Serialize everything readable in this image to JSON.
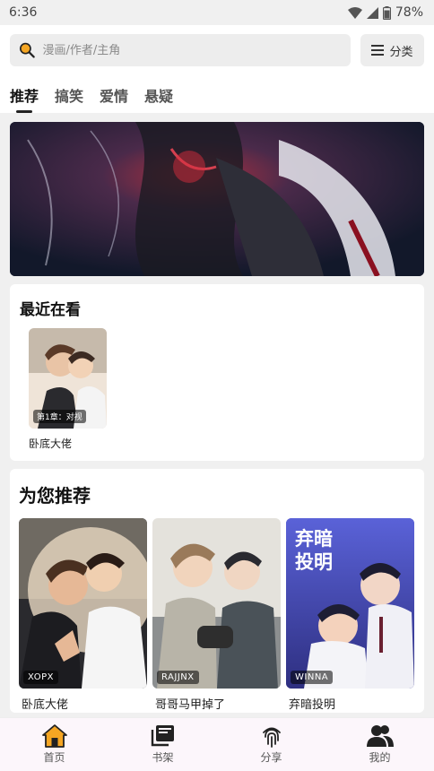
{
  "status": {
    "time": "6:36",
    "battery": "78%"
  },
  "search": {
    "placeholder": "漫画/作者/主角"
  },
  "category_button": {
    "label": "分类"
  },
  "tabs": [
    {
      "label": "推荐",
      "active": true
    },
    {
      "label": "搞笑",
      "active": false
    },
    {
      "label": "爱情",
      "active": false
    },
    {
      "label": "悬疑",
      "active": false
    }
  ],
  "recent": {
    "title": "最近在看",
    "items": [
      {
        "name": "卧底大佬",
        "chapter": "第1章：对视"
      }
    ]
  },
  "recommend": {
    "title": "为您推荐",
    "items": [
      {
        "name": "卧底大佬",
        "author": "XOPX"
      },
      {
        "name": "哥哥马甲掉了",
        "author": "RAJJNX"
      },
      {
        "name": "弃暗投明",
        "author": "WINNA",
        "cover_title": "弃暗投明"
      }
    ]
  },
  "bottom_nav": [
    {
      "label": "首页",
      "icon": "home-icon",
      "active": true
    },
    {
      "label": "书架",
      "icon": "bookshelf-icon",
      "active": false
    },
    {
      "label": "分享",
      "icon": "fingerprint-icon",
      "active": false
    },
    {
      "label": "我的",
      "icon": "users-icon",
      "active": false
    }
  ],
  "colors": {
    "accent": "#f5a623",
    "dark": "#222222",
    "nav_bg": "#fcf6fb"
  }
}
